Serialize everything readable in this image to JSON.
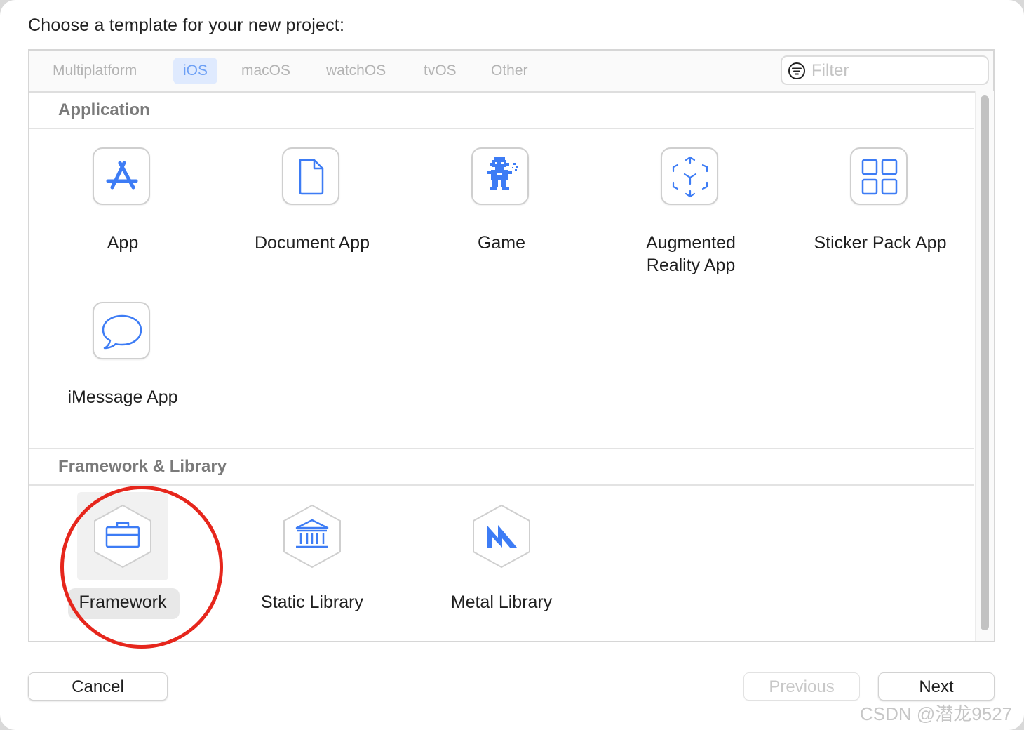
{
  "dialog": {
    "heading": "Choose a template for your new project:"
  },
  "tabs": [
    {
      "label": "Multiplatform",
      "active": false
    },
    {
      "label": "iOS",
      "active": true
    },
    {
      "label": "macOS",
      "active": false
    },
    {
      "label": "watchOS",
      "active": false
    },
    {
      "label": "tvOS",
      "active": false
    },
    {
      "label": "Other",
      "active": false
    }
  ],
  "filter": {
    "placeholder": "Filter",
    "value": ""
  },
  "sections": [
    {
      "title": "Application",
      "templates": [
        {
          "label": "App",
          "icon": "app-store-icon"
        },
        {
          "label": "Document App",
          "icon": "document-icon"
        },
        {
          "label": "Game",
          "icon": "game-character-icon"
        },
        {
          "label": "Augmented Reality App",
          "label_line1": "Augmented",
          "label_line2": "Reality App",
          "icon": "ar-cube-icon"
        },
        {
          "label": "Sticker Pack App",
          "icon": "grid-icon"
        },
        {
          "label": "iMessage App",
          "icon": "speech-bubble-icon"
        }
      ]
    },
    {
      "title": "Framework & Library",
      "templates": [
        {
          "label": "Framework",
          "icon": "toolbox-icon",
          "selected": true
        },
        {
          "label": "Static Library",
          "icon": "library-building-icon"
        },
        {
          "label": "Metal Library",
          "icon": "metal-icon"
        }
      ]
    }
  ],
  "buttons": {
    "cancel": "Cancel",
    "previous": "Previous",
    "next": "Next"
  },
  "watermark": "CSDN @潜龙9527",
  "colors": {
    "accent": "#3d7cf5",
    "tab_active_bg": "#dfeafe",
    "annotation_ring": "#e6261c"
  }
}
